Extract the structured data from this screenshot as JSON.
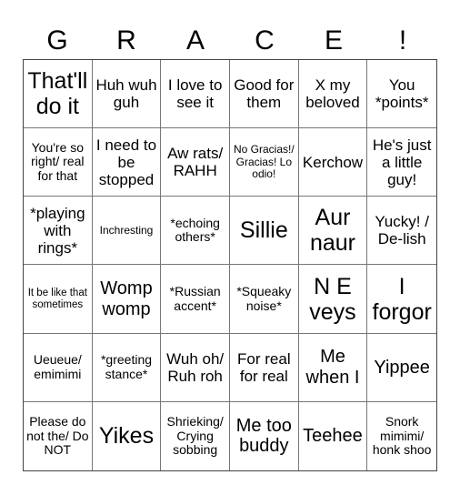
{
  "title_letters": [
    "G",
    "R",
    "A",
    "C",
    "E",
    "!"
  ],
  "cells": [
    {
      "text": "That'll do it",
      "size": "xl"
    },
    {
      "text": "Huh wuh guh",
      "size": "m"
    },
    {
      "text": "I love to see it",
      "size": "m"
    },
    {
      "text": "Good for them",
      "size": "m"
    },
    {
      "text": "X my beloved",
      "size": "m"
    },
    {
      "text": "You *points*",
      "size": "m"
    },
    {
      "text": "You're so right/ real for that",
      "size": "s"
    },
    {
      "text": "I need to be stopped",
      "size": "m"
    },
    {
      "text": "Aw rats/ RAHH",
      "size": "m"
    },
    {
      "text": "No Gracias!/ Gracias! Lo odio!",
      "size": "xs"
    },
    {
      "text": "Kerchow",
      "size": "m"
    },
    {
      "text": "He's just a little guy!",
      "size": "m"
    },
    {
      "text": "*playing with rings*",
      "size": "m"
    },
    {
      "text": "Inchresting",
      "size": "xs"
    },
    {
      "text": "*echoing others*",
      "size": "s"
    },
    {
      "text": "Sillie",
      "size": "xl"
    },
    {
      "text": "Aur naur",
      "size": "xl"
    },
    {
      "text": "Yucky! / De-lish",
      "size": "m"
    },
    {
      "text": "It be like that sometimes",
      "size": "xxs"
    },
    {
      "text": "Womp womp",
      "size": "l"
    },
    {
      "text": "*Russian accent*",
      "size": "s"
    },
    {
      "text": "*Squeaky noise*",
      "size": "s"
    },
    {
      "text": "N E veys",
      "size": "xl"
    },
    {
      "text": "I forgor",
      "size": "xl"
    },
    {
      "text": "Ueueue/ emimimi",
      "size": "s"
    },
    {
      "text": "*greeting stance*",
      "size": "s"
    },
    {
      "text": "Wuh oh/ Ruh roh",
      "size": "m"
    },
    {
      "text": "For real for real",
      "size": "m"
    },
    {
      "text": "Me when I",
      "size": "l"
    },
    {
      "text": "Yippee",
      "size": "l"
    },
    {
      "text": "Please do not the/ Do NOT",
      "size": "s"
    },
    {
      "text": "Yikes",
      "size": "xl"
    },
    {
      "text": "Shrieking/ Crying sobbing",
      "size": "s"
    },
    {
      "text": "Me too buddy",
      "size": "l"
    },
    {
      "text": "Teehee",
      "size": "l"
    },
    {
      "text": "Snork mimimi/ honk shoo",
      "size": "s"
    }
  ]
}
